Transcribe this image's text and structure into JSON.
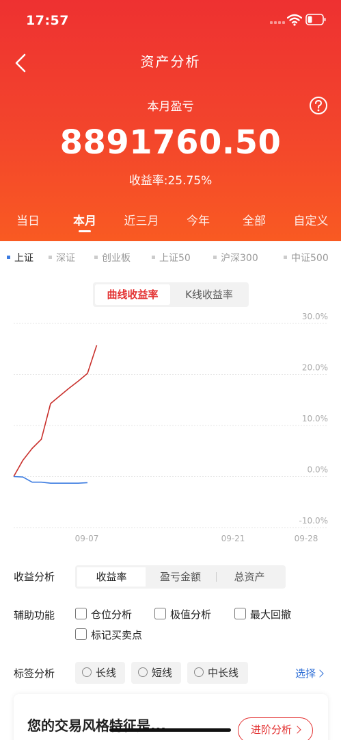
{
  "status_bar": {
    "time": "17:57"
  },
  "header": {
    "title": "资产分析",
    "period_label": "本月盈亏",
    "profit_amount": "8891760.50",
    "yield_rate": "收益率:25.75%"
  },
  "period_tabs": [
    {
      "label": "当日",
      "active": false
    },
    {
      "label": "本月",
      "active": true
    },
    {
      "label": "近三月",
      "active": false
    },
    {
      "label": "今年",
      "active": false
    },
    {
      "label": "全部",
      "active": false
    },
    {
      "label": "自定义",
      "active": false
    }
  ],
  "indices": [
    {
      "label": "上证",
      "active": true
    },
    {
      "label": "深证",
      "active": false
    },
    {
      "label": "创业板",
      "active": false
    },
    {
      "label": "上证50",
      "active": false
    },
    {
      "label": "沪深300",
      "active": false
    },
    {
      "label": "中证500",
      "active": false
    }
  ],
  "chart_toggle": {
    "curve": "曲线收益率",
    "kline": "K线收益率"
  },
  "colors": {
    "accent": "#e33232",
    "benchmark_line": "#3b7be0",
    "portfolio_line": "#c9302c",
    "link": "#2f6fd6"
  },
  "chart_data": {
    "type": "line",
    "y_unit": "%",
    "ylim": [
      -10,
      30
    ],
    "y_ticks": [
      "30.0%",
      "20.0%",
      "10.0%",
      "0.0%",
      "-10.0%"
    ],
    "x_tick_labels": [
      "09-07",
      "09-21",
      "09-28"
    ],
    "grid": true,
    "series": [
      {
        "values": [
          0.0,
          3.2,
          5.5,
          7.3,
          14.3,
          15.8,
          17.3,
          18.7,
          20.2,
          25.7
        ]
      },
      {
        "values": [
          0.0,
          -0.1,
          -1.1,
          -1.1,
          -1.3,
          -1.3,
          -1.3,
          -1.3,
          -1.2
        ]
      }
    ]
  },
  "analysis": {
    "label": "收益分析",
    "options": [
      {
        "label": "收益率",
        "active": true
      },
      {
        "label": "盈亏金额",
        "active": false
      },
      {
        "label": "总资产",
        "active": false
      }
    ]
  },
  "aux": {
    "label": "辅助功能",
    "options": [
      "仓位分析",
      "极值分析",
      "最大回撤",
      "标记买卖点"
    ]
  },
  "tags": {
    "label": "标签分析",
    "options": [
      "长线",
      "短线",
      "中长线"
    ],
    "select": "选择"
  },
  "style_card": {
    "title": "您的交易风格特征是...",
    "button": "进阶分析"
  }
}
